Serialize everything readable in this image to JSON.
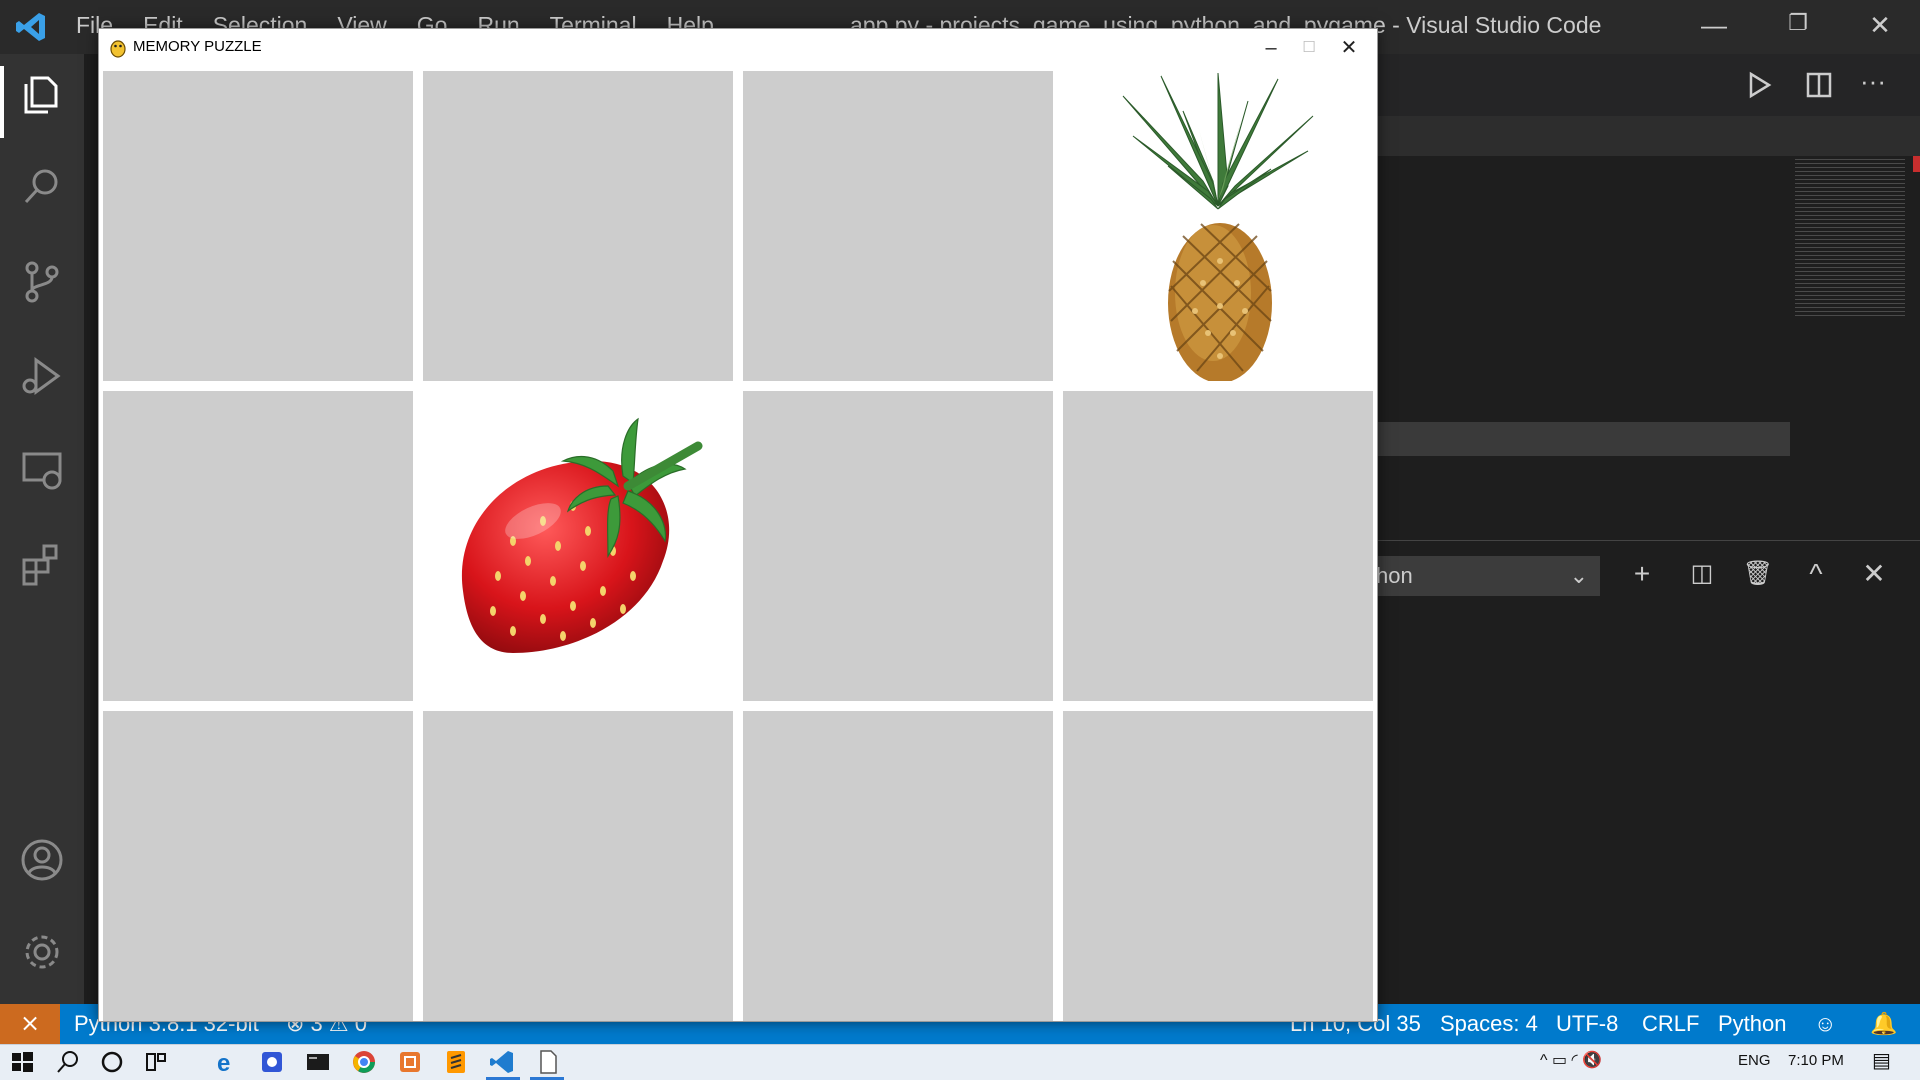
{
  "vscode": {
    "menu": [
      "File",
      "Edit",
      "Selection",
      "View",
      "Go",
      "Run",
      "Terminal",
      "Help"
    ],
    "window_title": "app.py - projects_game_using_python_and_pygame - Visual Studio Code",
    "terminal_dropdown": "hon",
    "status_left": {
      "python": "Python 3.8.1 32-bit",
      "problems": "⊗ 3 ⚠ 0"
    },
    "status_right": {
      "position": "Ln 10, Col 35",
      "spaces": "Spaces: 4",
      "encoding": "UTF-8",
      "eol": "CRLF",
      "language": "Python"
    }
  },
  "game": {
    "title": "MEMORY PUZZLE",
    "grid": {
      "rows": 3,
      "cols": 4
    },
    "cards": [
      {
        "row": 0,
        "col": 0,
        "state": "hidden"
      },
      {
        "row": 0,
        "col": 1,
        "state": "hidden"
      },
      {
        "row": 0,
        "col": 2,
        "state": "hidden"
      },
      {
        "row": 0,
        "col": 3,
        "state": "revealed",
        "fruit": "pineapple"
      },
      {
        "row": 1,
        "col": 0,
        "state": "hidden"
      },
      {
        "row": 1,
        "col": 1,
        "state": "revealed",
        "fruit": "strawberry"
      },
      {
        "row": 1,
        "col": 2,
        "state": "hidden"
      },
      {
        "row": 1,
        "col": 3,
        "state": "hidden"
      },
      {
        "row": 2,
        "col": 0,
        "state": "hidden"
      },
      {
        "row": 2,
        "col": 1,
        "state": "hidden"
      },
      {
        "row": 2,
        "col": 2,
        "state": "hidden"
      },
      {
        "row": 2,
        "col": 3,
        "state": "hidden"
      }
    ],
    "colors": {
      "hidden_card": "#cdcdcd",
      "revealed_card": "#ffffff",
      "gap": "#ffffff"
    }
  },
  "taskbar": {
    "time": "7:10 PM",
    "lang": "ENG",
    "icons": [
      "windows-start-icon",
      "search-icon",
      "cortana-icon",
      "task-view-icon",
      "edge-icon",
      "app-icon",
      "terminal-icon",
      "chrome-icon",
      "app-icon-2",
      "sublime-icon",
      "vscode-icon",
      "file-icon"
    ]
  }
}
